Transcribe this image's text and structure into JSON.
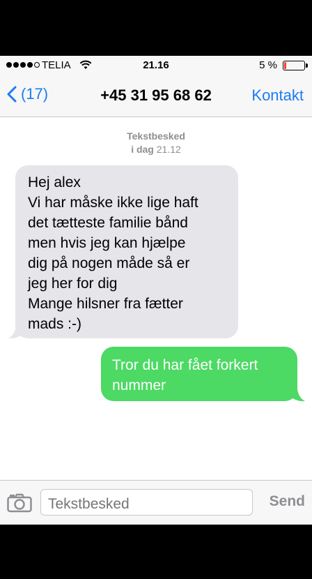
{
  "status_bar": {
    "carrier": "TELIA",
    "time": "21.16",
    "battery_percent": "5 %",
    "battery_level": 0.05,
    "signal_bars_filled": 4,
    "signal_bars_total": 5
  },
  "nav": {
    "back_label": "(17)",
    "title": "+45 31 95 68 62",
    "contact_label": "Kontakt"
  },
  "timestamp": {
    "type_label": "Tekstbesked",
    "day": "i dag",
    "time": "21.12"
  },
  "messages": [
    {
      "direction": "incoming",
      "text": "Hej alex\nVi har måske ikke lige haft\ndet tætteste familie bånd\nmen hvis jeg kan hjælpe\ndig på nogen måde så er\njeg her for dig\nMange hilsner fra fætter\nmads :-)"
    },
    {
      "direction": "outgoing",
      "text": "Tror du har fået forkert\nnummer"
    }
  ],
  "input": {
    "placeholder": "Tekstbesked",
    "send_label": "Send"
  },
  "colors": {
    "accent": "#1a7cf5",
    "incoming_bubble": "#e5e5ea",
    "outgoing_bubble": "#4cd964",
    "battery_low": "#ff3b30"
  }
}
